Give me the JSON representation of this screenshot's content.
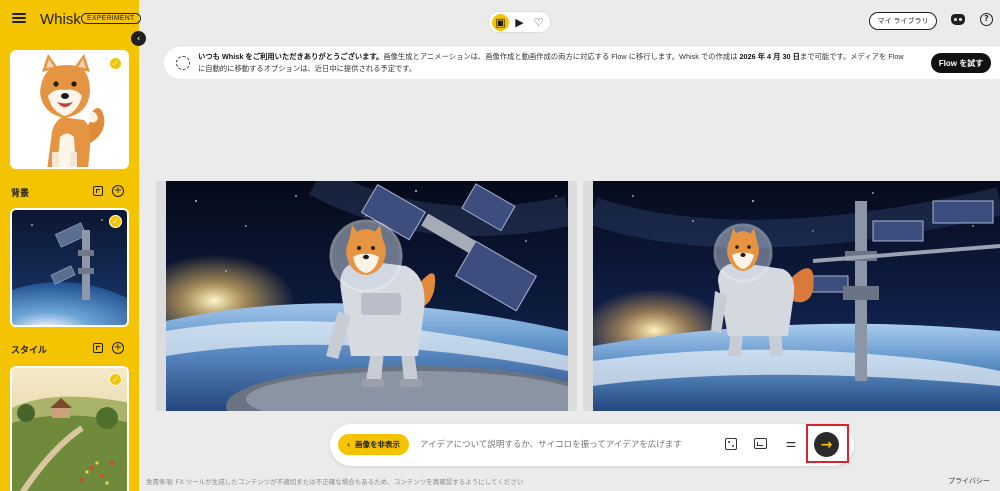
{
  "app": {
    "brand": "Whisk",
    "badge": "EXPERIMENT"
  },
  "sidebar": {
    "background_label": "背景",
    "style_label": "スタイル"
  },
  "header": {
    "library_label": "マイ ライブラリ"
  },
  "banner": {
    "text_1": "いつも Whisk をご利用いただきありがとうございます。",
    "text_2": "画像生成とアニメーションは、画像作成と動画作成の両方に対応する Flow に移行します。Whisk での作成は ",
    "text_date": "2026 年 4 月 30 日",
    "text_3": "まで可能です。メディアを Flow に自動的に移動するオプションは、近日中に提供される予定です。",
    "cta": "Flow を試す"
  },
  "prompt": {
    "hide_label": "画像を非表示",
    "placeholder": "アイデアについて説明するか、サイコロを振ってアイデアを広げます"
  },
  "footer": {
    "disclaimer": "免責条項: FX ツールが生成したコンテンツが不適切または不正確な場合もあるため、コンテンツを再確認するようにしてください",
    "privacy": "プライバシー"
  },
  "colors": {
    "accent": "#f5c400",
    "dark": "#1f1f1f",
    "highlight": "#d9232d"
  }
}
